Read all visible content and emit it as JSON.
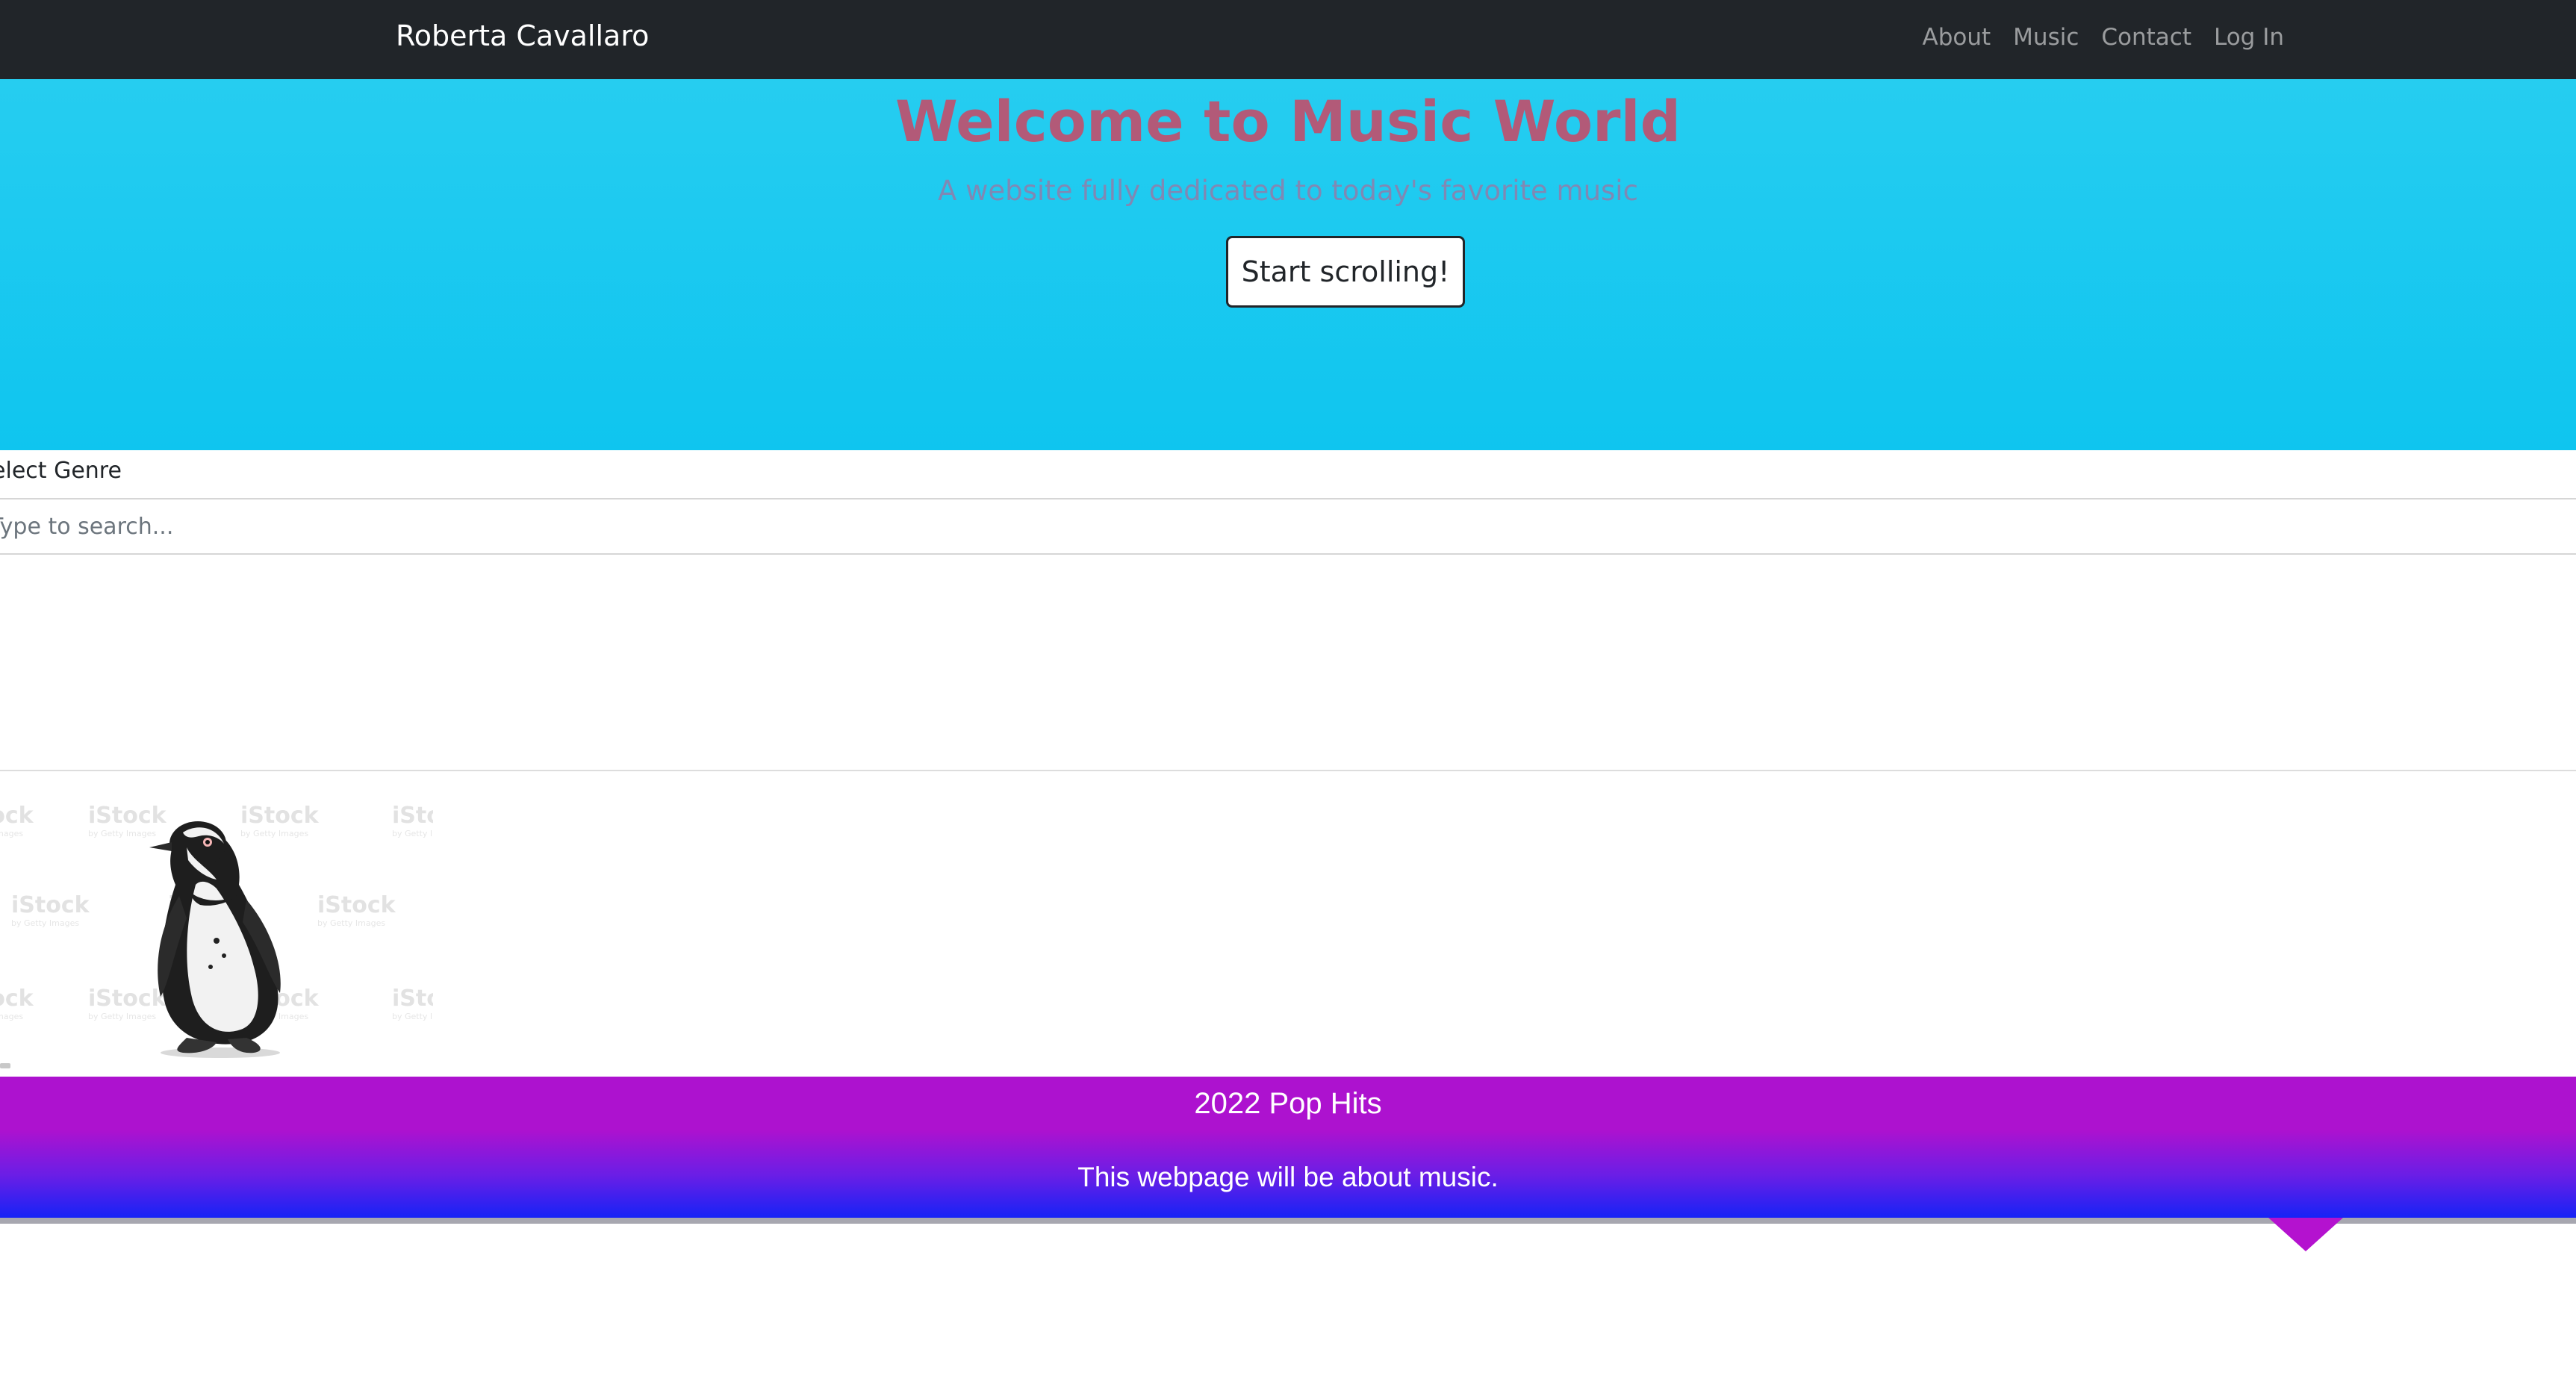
{
  "navbar": {
    "brand": "Roberta Cavallaro",
    "links": [
      {
        "label": "About"
      },
      {
        "label": "Music"
      },
      {
        "label": "Contact"
      },
      {
        "label": "Log In"
      }
    ],
    "background": "#212529"
  },
  "hero": {
    "title": "Welcome to Music World",
    "subtitle": "A website fully dedicated to today's favorite music",
    "button_label": "Start scrolling!",
    "background": "#1ec9f0",
    "title_color": "#b25a78"
  },
  "filters": {
    "genre_select_label": "Select Genre",
    "search_placeholder": "Type to search..."
  },
  "image": {
    "subject": "penguin",
    "watermark_text": "iStock",
    "watermark_subtext": "by Getty Images"
  },
  "footer": {
    "title": "2022 Pop Hits",
    "text": "This webpage will be about music.",
    "gradient_top": "#ad12cf",
    "gradient_bottom": "#1623f6"
  }
}
